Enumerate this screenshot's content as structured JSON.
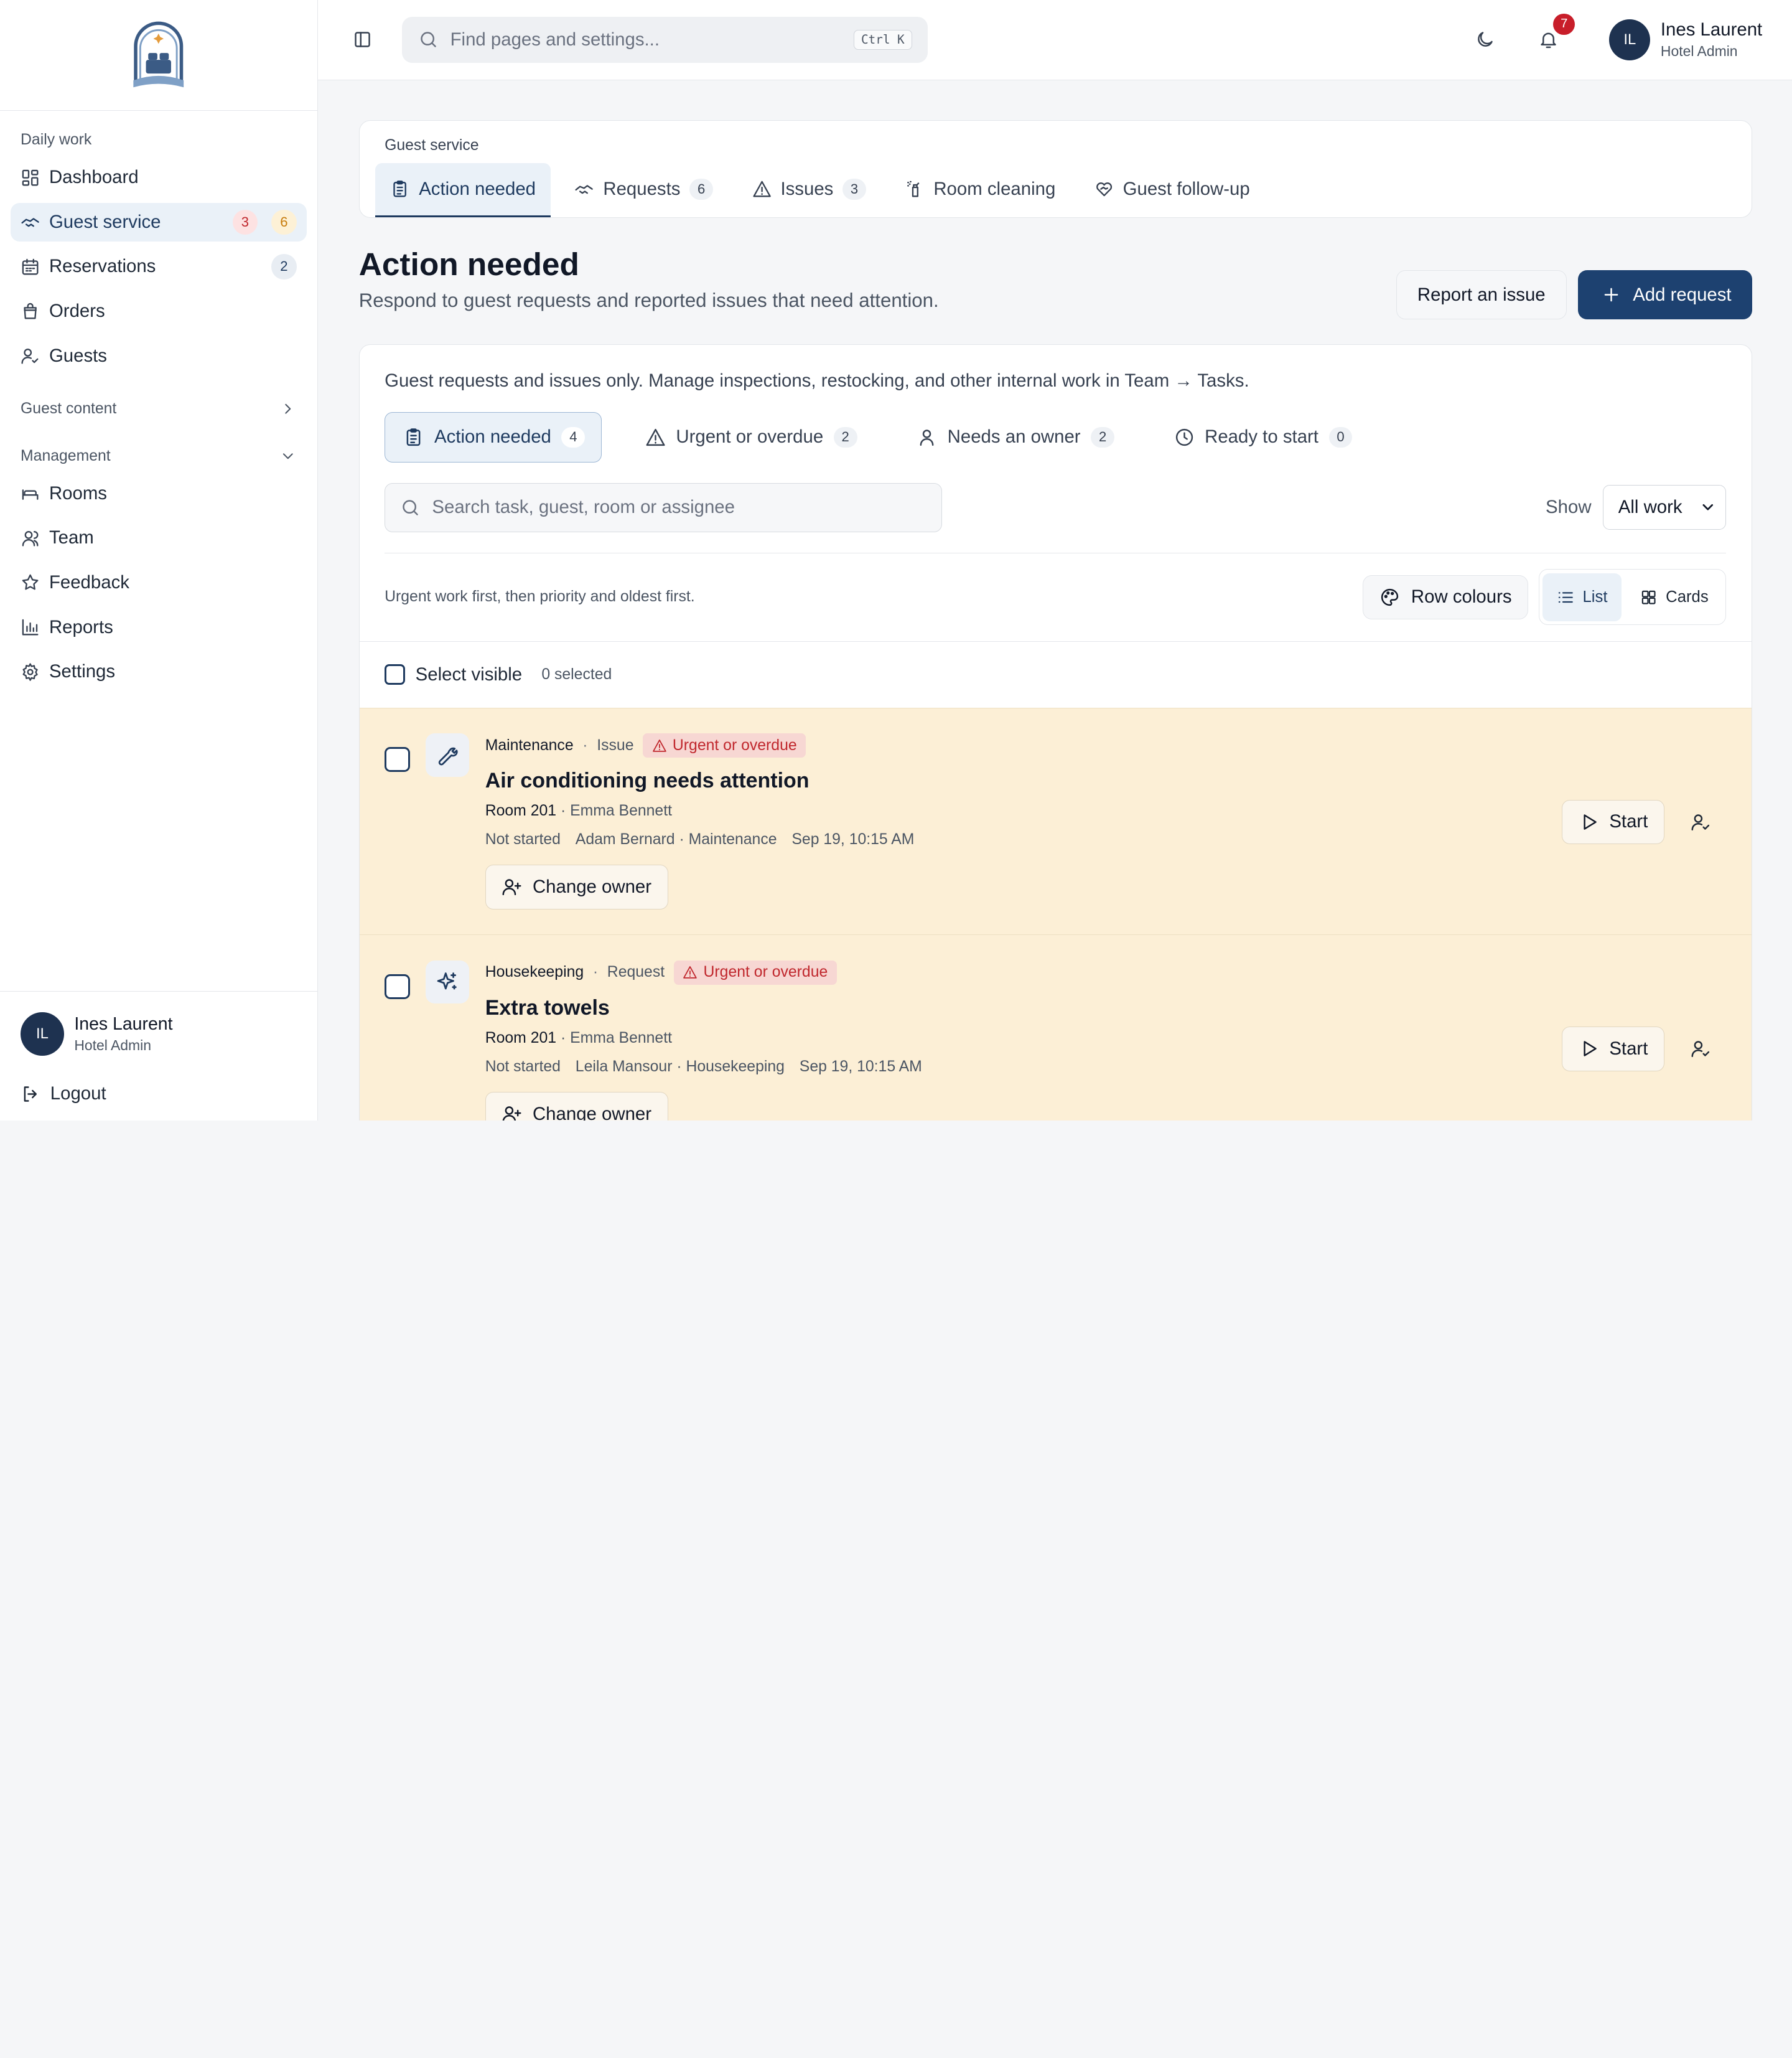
{
  "brand": {
    "logo_icon": "hotel-bed-logo-icon"
  },
  "sidebar": {
    "sections": [
      {
        "label": "Daily work"
      },
      {
        "label": "Guest content"
      },
      {
        "label": "Management"
      }
    ],
    "daily": [
      {
        "label": "Dashboard",
        "icon": "dashboard-icon"
      },
      {
        "label": "Guest service",
        "icon": "handshake-icon",
        "badge_urgent": "3",
        "badge_pending": "6"
      },
      {
        "label": "Reservations",
        "icon": "calendar-icon",
        "badge": "2"
      },
      {
        "label": "Orders",
        "icon": "bag-icon"
      },
      {
        "label": "Guests",
        "icon": "user-check-icon"
      }
    ],
    "management": [
      {
        "label": "Rooms",
        "icon": "bed-icon"
      },
      {
        "label": "Team",
        "icon": "users-icon"
      },
      {
        "label": "Feedback",
        "icon": "star-icon"
      },
      {
        "label": "Reports",
        "icon": "bar-chart-icon"
      },
      {
        "label": "Settings",
        "icon": "gear-icon"
      }
    ],
    "user": {
      "initials": "IL",
      "name": "Ines Laurent",
      "role": "Hotel Admin"
    },
    "logout": "Logout"
  },
  "topbar": {
    "search_placeholder": "Find pages and settings...",
    "shortcut": "Ctrl K",
    "notifications": "7",
    "user": {
      "initials": "IL",
      "name": "Ines Laurent",
      "role": "Hotel Admin"
    }
  },
  "tabs": {
    "kicker": "Guest service",
    "items": [
      {
        "label": "Action needed",
        "icon": "clipboard-icon"
      },
      {
        "label": "Requests",
        "count": "6",
        "icon": "handshake-icon"
      },
      {
        "label": "Issues",
        "count": "3",
        "icon": "alert-triangle-icon"
      },
      {
        "label": "Room cleaning",
        "icon": "spray-bottle-icon"
      },
      {
        "label": "Guest follow-up",
        "icon": "heart-handshake-icon"
      }
    ]
  },
  "page": {
    "title": "Action needed",
    "subtitle": "Respond to guest requests and reported issues that need attention.",
    "report_btn": "Report an issue",
    "add_btn": "Add request"
  },
  "work": {
    "note": "Guest requests and issues only. Manage inspections, restocking, and other internal work in Team → Tasks.",
    "filters": [
      {
        "label": "Action needed",
        "count": "4"
      },
      {
        "label": "Urgent or overdue",
        "count": "2"
      },
      {
        "label": "Needs an owner",
        "count": "2"
      },
      {
        "label": "Ready to start",
        "count": "0"
      }
    ],
    "search_placeholder": "Search task, guest, room or assignee",
    "show_label": "Show",
    "show_value": "All work",
    "sort_note": "Urgent work first, then priority and oldest first.",
    "row_colours": "Row colours",
    "view_list": "List",
    "view_cards": "Cards",
    "select_visible": "Select visible",
    "selected": "0 selected"
  },
  "tasks": [
    {
      "department": "Maintenance",
      "kind": "Issue",
      "flag": "Urgent or overdue",
      "icon": "wrench-icon",
      "title": "Air conditioning needs attention",
      "room": "Room 201",
      "guest": "Emma Bennett",
      "status": "Not started",
      "assignee": "Adam Bernard · Maintenance",
      "time": "Sep 19, 10:15 AM",
      "owner_btn": "Change owner",
      "start": "Start"
    },
    {
      "department": "Housekeeping",
      "kind": "Request",
      "flag": "Urgent or overdue",
      "icon": "sparkles-icon",
      "title": "Extra towels",
      "room": "Room 201",
      "guest": "Emma Bennett",
      "status": "Not started",
      "assignee": "Leila Mansour · Housekeeping",
      "time": "Sep 19, 10:15 AM",
      "owner_btn": "Change owner",
      "start": "Start"
    }
  ]
}
